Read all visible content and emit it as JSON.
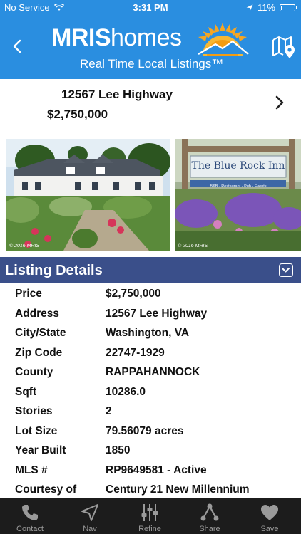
{
  "status_bar": {
    "carrier": "No Service",
    "time": "3:31 PM",
    "battery": "11%",
    "battery_level": 0.11
  },
  "header": {
    "logo_bold": "MRIS",
    "logo_light": "homes",
    "tagline": "Real Time Local Listings™"
  },
  "listing": {
    "address": "12567 Lee Highway",
    "price": "$2,750,000",
    "photos": [
      {
        "copyright": "© 2016 MRIS"
      },
      {
        "copyright": "© 2016 MRIS",
        "sign_text": "The Blue Rock Inn",
        "sign_subtext": "B&B · Restaurant · Pub · Events"
      }
    ]
  },
  "details": {
    "title": "Listing Details",
    "rows": [
      {
        "label": "Price",
        "value": "$2,750,000"
      },
      {
        "label": "Address",
        "value": "12567 Lee Highway"
      },
      {
        "label": "City/State",
        "value": "Washington, VA"
      },
      {
        "label": "Zip Code",
        "value": "22747-1929"
      },
      {
        "label": "County",
        "value": "RAPPAHANNOCK"
      },
      {
        "label": "Sqft",
        "value": "10286.0"
      },
      {
        "label": "Stories",
        "value": "2"
      },
      {
        "label": "Lot Size",
        "value": "79.56079 acres"
      },
      {
        "label": "Year Built",
        "value": "1850"
      },
      {
        "label": "MLS #",
        "value": "RP9649581 - Active"
      },
      {
        "label": "Courtesy of",
        "value": "Century 21 New Millennium"
      }
    ]
  },
  "tabs": [
    {
      "label": "Contact",
      "icon": "phone-icon"
    },
    {
      "label": "Nav",
      "icon": "navigation-arrow-icon"
    },
    {
      "label": "Refine",
      "icon": "sliders-icon"
    },
    {
      "label": "Share",
      "icon": "share-icon"
    },
    {
      "label": "Save",
      "icon": "heart-icon"
    }
  ],
  "colors": {
    "header_blue": "#2a8ee0",
    "section_bar": "#3a4f8a",
    "tabbar_bg": "#1c1c1c",
    "tab_icon": "#9a9a9a"
  }
}
